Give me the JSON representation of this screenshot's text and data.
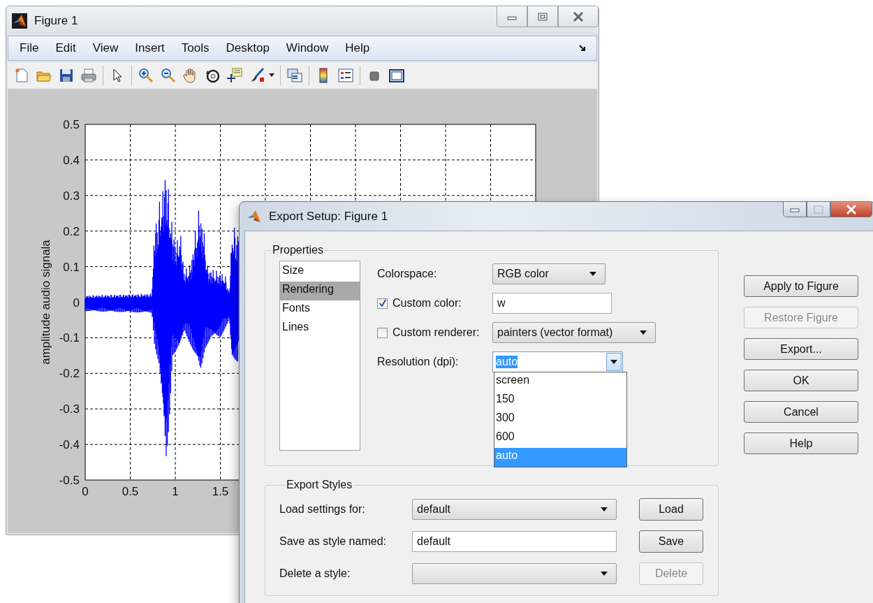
{
  "figure_window": {
    "title": "Figure 1",
    "menu": [
      "File",
      "Edit",
      "View",
      "Insert",
      "Tools",
      "Desktop",
      "Window",
      "Help"
    ],
    "plot": {
      "ylabel": "amplitude audio signala",
      "yticks": [
        "0.5",
        "0.4",
        "0.3",
        "0.2",
        "0.1",
        "0",
        "-0.1",
        "-0.2",
        "-0.3",
        "-0.4",
        "-0.5"
      ],
      "xticks": [
        "0",
        "0.5",
        "1",
        "1.5"
      ]
    }
  },
  "export_dialog": {
    "title": "Export Setup: Figure 1",
    "properties": {
      "legend": "Properties",
      "categories": [
        {
          "label": "Size",
          "selected": false
        },
        {
          "label": "Rendering",
          "selected": true
        },
        {
          "label": "Fonts",
          "selected": false
        },
        {
          "label": "Lines",
          "selected": false
        }
      ],
      "colorspace": {
        "label": "Colorspace:",
        "value": "RGB color"
      },
      "custom_color": {
        "label": "Custom color:",
        "checked": true,
        "value": "w"
      },
      "custom_renderer": {
        "label": "Custom renderer:",
        "checked": false,
        "value": "painters (vector format)"
      },
      "resolution": {
        "label": "Resolution (dpi):",
        "value": "auto",
        "expanded": true,
        "options": [
          {
            "label": "screen",
            "selected": false
          },
          {
            "label": "150",
            "selected": false
          },
          {
            "label": "300",
            "selected": false
          },
          {
            "label": "600",
            "selected": false
          },
          {
            "label": "auto",
            "selected": true
          }
        ]
      }
    },
    "buttons": [
      {
        "label": "Apply to Figure",
        "disabled": false
      },
      {
        "label": "Restore Figure",
        "disabled": true
      },
      {
        "label": "Export...",
        "disabled": false
      },
      {
        "label": "OK",
        "disabled": false
      },
      {
        "label": "Cancel",
        "disabled": false
      },
      {
        "label": "Help",
        "disabled": false
      }
    ],
    "export_styles": {
      "legend": "Export Styles",
      "rows": [
        {
          "kind": "dropdown",
          "label": "Load settings for:",
          "value": "default",
          "button": {
            "label": "Load",
            "disabled": false
          }
        },
        {
          "kind": "field",
          "label": "Save as style named:",
          "value": "default",
          "button": {
            "label": "Save",
            "disabled": false
          }
        },
        {
          "kind": "dropdown",
          "label": "Delete a style:",
          "button": {
            "label": "Delete",
            "disabled": true
          }
        }
      ]
    }
  }
}
